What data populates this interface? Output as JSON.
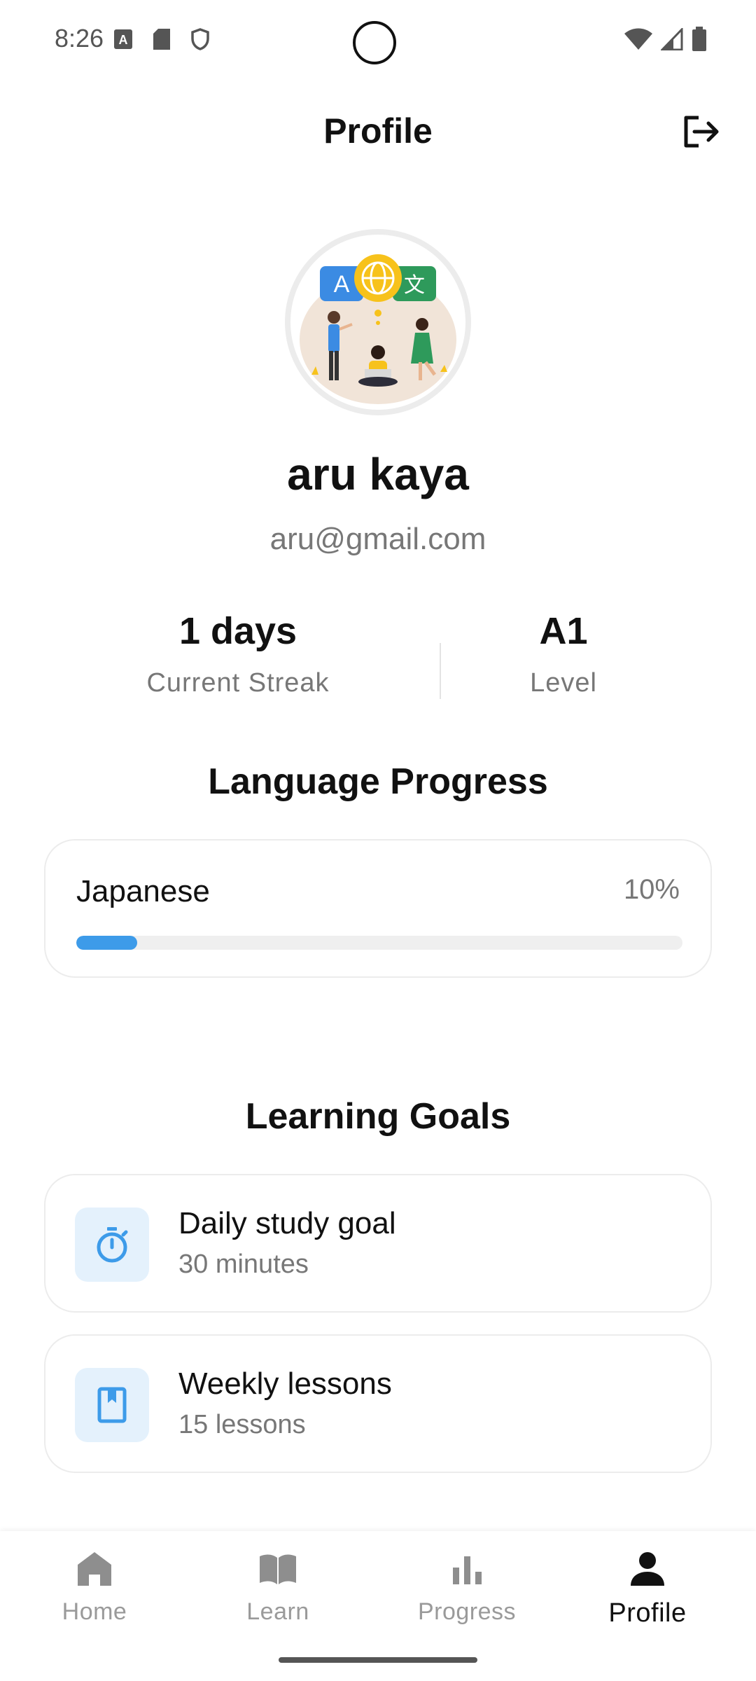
{
  "status_bar": {
    "time": "8:26"
  },
  "header": {
    "title": "Profile"
  },
  "user": {
    "name": "aru kaya",
    "email": "aru@gmail.com"
  },
  "stats": [
    {
      "value": "1 days",
      "label": "Current Streak"
    },
    {
      "value": "A1",
      "label": "Level"
    }
  ],
  "language_progress": {
    "title": "Language Progress",
    "items": [
      {
        "language": "Japanese",
        "percent_label": "10%",
        "percent": 10
      }
    ]
  },
  "learning_goals": {
    "title": "Learning Goals",
    "items": [
      {
        "title": "Daily study goal",
        "value": "30 minutes",
        "icon": "timer-icon"
      },
      {
        "title": "Weekly lessons",
        "value": "15 lessons",
        "icon": "bookmark-book-icon"
      }
    ]
  },
  "bottom_nav": {
    "items": [
      {
        "label": "Home",
        "icon": "home-icon",
        "active": false
      },
      {
        "label": "Learn",
        "icon": "book-open-icon",
        "active": false
      },
      {
        "label": "Progress",
        "icon": "bar-chart-icon",
        "active": false
      },
      {
        "label": "Profile",
        "icon": "person-icon",
        "active": true
      }
    ]
  },
  "colors": {
    "accent": "#3d9be9",
    "goal_icon_bg": "#e4f1fc",
    "text_secondary": "#777777"
  }
}
